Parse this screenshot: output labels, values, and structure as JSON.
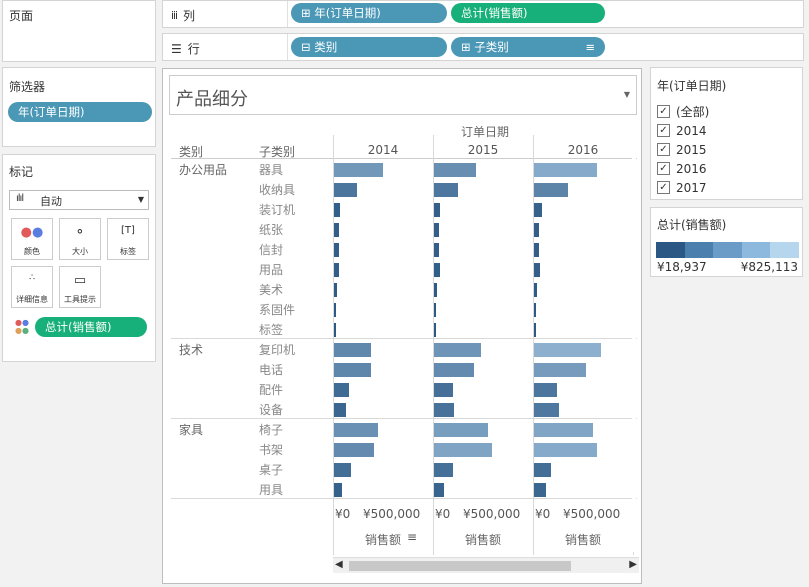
{
  "pages": {
    "title": "页面"
  },
  "shelves": {
    "columns": {
      "label": "列",
      "pills": [
        "年(订单日期)",
        "总计(销售额)"
      ]
    },
    "rows": {
      "label": "行",
      "pills": [
        "类别",
        "子类别"
      ]
    }
  },
  "filters": {
    "title": "筛选器",
    "pills": [
      "年(订单日期)"
    ]
  },
  "marks": {
    "title": "标记",
    "type": "自动",
    "buttons": [
      "颜色",
      "大小",
      "标签",
      "详细信息",
      "工具提示"
    ],
    "pill": "总计(销售额)"
  },
  "view": {
    "title": "产品细分",
    "col_header": "订单日期",
    "cat_header": "类别",
    "sub_header": "子类别",
    "axis_title": "销售额"
  },
  "chart_data": {
    "type": "bar",
    "title": "产品细分",
    "xlabel": "销售额",
    "columns": [
      "2014",
      "2015",
      "2016"
    ],
    "xlim": [
      0,
      825113
    ],
    "tick_labels": [
      "¥0",
      "¥500,000"
    ],
    "tick_values": [
      0,
      500000
    ],
    "categories": [
      {
        "name": "办公用品",
        "subs": [
          "器具",
          "收纳具",
          "装订机",
          "纸张",
          "信封",
          "用品",
          "美术",
          "系固件",
          "标签"
        ]
      },
      {
        "name": "技术",
        "subs": [
          "复印机",
          "电话",
          "配件",
          "设备"
        ]
      },
      {
        "name": "家具",
        "subs": [
          "椅子",
          "书架",
          "桌子",
          "用具"
        ]
      }
    ],
    "series": [
      {
        "year": "2014",
        "values": [
          420000,
          195000,
          50000,
          45000,
          45000,
          45000,
          30000,
          20000,
          15000,
          320000,
          315000,
          130000,
          100000,
          375000,
          340000,
          150000,
          65000
        ]
      },
      {
        "year": "2015",
        "values": [
          365000,
          205000,
          55000,
          45000,
          45000,
          50000,
          30000,
          15000,
          15000,
          400000,
          340000,
          165000,
          175000,
          460000,
          500000,
          160000,
          85000
        ]
      },
      {
        "year": "2016",
        "values": [
          540000,
          295000,
          70000,
          45000,
          45000,
          55000,
          30000,
          20000,
          15000,
          580000,
          445000,
          200000,
          215000,
          510000,
          540000,
          150000,
          100000
        ]
      }
    ]
  },
  "year_filter": {
    "title": "年(订单日期)",
    "items": [
      "(全部)",
      "2014",
      "2015",
      "2016",
      "2017"
    ]
  },
  "color_legend": {
    "title": "总计(销售额)",
    "min_label": "¥18,937",
    "max_label": "¥825,113",
    "swatches": [
      "#2a5783",
      "#4a7fae",
      "#6a9cc7",
      "#8db9de",
      "#b6d6ee"
    ]
  },
  "colors": {
    "bar_low": "#2a5783",
    "bar_high": "#b6d6ee",
    "pill_blue": "#4a97b6",
    "pill_green": "#18b07a"
  }
}
